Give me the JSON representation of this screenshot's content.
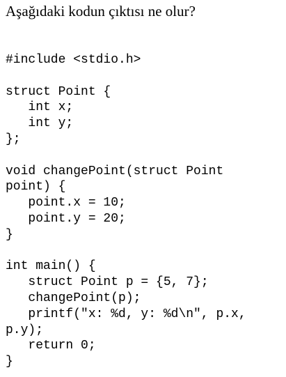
{
  "question": "Aşağıdaki kodun çıktısı ne olur?",
  "code_lines": [
    "#include <stdio.h>",
    "",
    "struct Point {",
    "   int x;",
    "   int y;",
    "};",
    "",
    "void changePoint(struct Point",
    "point) {",
    "   point.x = 10;",
    "   point.y = 20;",
    "}",
    "",
    "int main() {",
    "   struct Point p = {5, 7};",
    "   changePoint(p);",
    "   printf(\"x: %d, y: %d\\n\", p.x,",
    "p.y);",
    "   return 0;",
    "}"
  ]
}
